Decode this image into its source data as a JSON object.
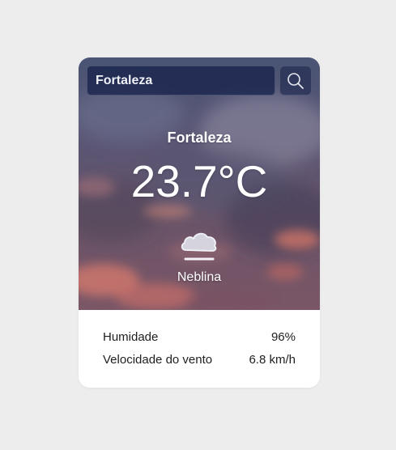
{
  "search": {
    "value": "Fortaleza",
    "icon": "search-icon"
  },
  "weather": {
    "city": "Fortaleza",
    "temperature": "23.7°C",
    "condition": "Neblina",
    "icon": "mist-cloud-icon"
  },
  "details": [
    {
      "label": "Humidade",
      "value": "96%"
    },
    {
      "label": "Velocidade do vento",
      "value": "6.8 km/h"
    }
  ],
  "colors": {
    "page_background": "#ededed",
    "search_background": "#1b264e",
    "text_on_hero": "#ffffff",
    "details_background": "#ffffff"
  }
}
